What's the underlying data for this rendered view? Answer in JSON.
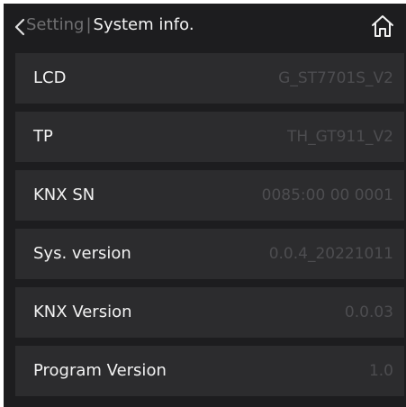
{
  "header": {
    "back_label": "Setting",
    "separator": "|",
    "title": "System info."
  },
  "icons": {
    "back": "chevron-left-icon",
    "home": "home-icon"
  },
  "colors": {
    "background": "#1d1d1f",
    "row_background": "#2c2c2e",
    "label_text": "#f2f2f2",
    "value_text": "#4d4d50",
    "muted_text": "#707072"
  },
  "info_rows": [
    {
      "label": "LCD",
      "value": "G_ST7701S_V2"
    },
    {
      "label": "TP",
      "value": "TH_GT911_V2"
    },
    {
      "label": "KNX SN",
      "value": "0085:00 00 0001"
    },
    {
      "label": "Sys. version",
      "value": "0.0.4_20221011"
    },
    {
      "label": "KNX Version",
      "value": "0.0.03"
    },
    {
      "label": "Program Version",
      "value": "1.0"
    }
  ]
}
